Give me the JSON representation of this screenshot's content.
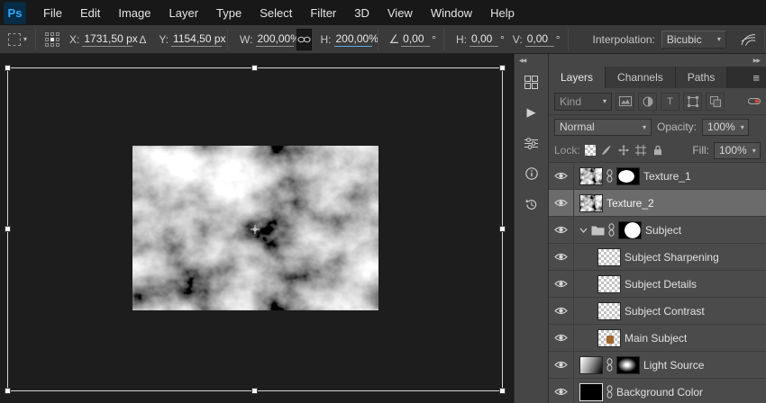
{
  "menubar": {
    "logo_text": "Ps",
    "items": [
      {
        "label": "File"
      },
      {
        "label": "Edit"
      },
      {
        "label": "Image"
      },
      {
        "label": "Layer"
      },
      {
        "label": "Type"
      },
      {
        "label": "Select"
      },
      {
        "label": "Filter"
      },
      {
        "label": "3D"
      },
      {
        "label": "View"
      },
      {
        "label": "Window"
      },
      {
        "label": "Help"
      }
    ]
  },
  "options_bar": {
    "x_label": "X:",
    "x_value": "1731,50 px",
    "y_label": "Y:",
    "y_value": "1154,50 px",
    "w_label": "W:",
    "w_value": "200,00%",
    "h_label": "H:",
    "h_value": "200,00%",
    "angle_value": "0,00",
    "angle_unit": "°",
    "skew_h_label": "H:",
    "skew_h_value": "0,00",
    "skew_h_unit": "°",
    "skew_v_label": "V:",
    "skew_v_value": "0,00",
    "skew_v_unit": "°",
    "interpolation_label": "Interpolation:",
    "interpolation_value": "Bicubic"
  },
  "layers_panel": {
    "tabs": [
      {
        "label": "Layers"
      },
      {
        "label": "Channels"
      },
      {
        "label": "Paths"
      }
    ],
    "kind_label": "Kind",
    "blend_mode": "Normal",
    "opacity_label": "Opacity:",
    "opacity_value": "100%",
    "lock_label": "Lock:",
    "fill_label": "Fill:",
    "fill_value": "100%",
    "layers": [
      {
        "name": "Texture_1"
      },
      {
        "name": "Texture_2",
        "selected": true
      },
      {
        "name": "Subject",
        "group": true
      },
      {
        "name": "Subject Sharpening"
      },
      {
        "name": "Subject Details"
      },
      {
        "name": "Subject Contrast"
      },
      {
        "name": "Main Subject"
      },
      {
        "name": "Light Source"
      },
      {
        "name": "Background Color"
      }
    ]
  },
  "icons": {
    "dropdown_arrow": "▾",
    "delta": "∆",
    "angle": "∠",
    "type_filter": "T",
    "collapse_dock": "◀◀",
    "collapse_panel": "▶▶",
    "panel_menu": "≡",
    "play": "▶"
  },
  "colors": {
    "logo_bg": "#082c45",
    "logo_text": "#31a8ff",
    "selected_layer": "#6b6b6b",
    "canvas_bg": "#1d1d1d",
    "panel_bg": "#464646"
  }
}
